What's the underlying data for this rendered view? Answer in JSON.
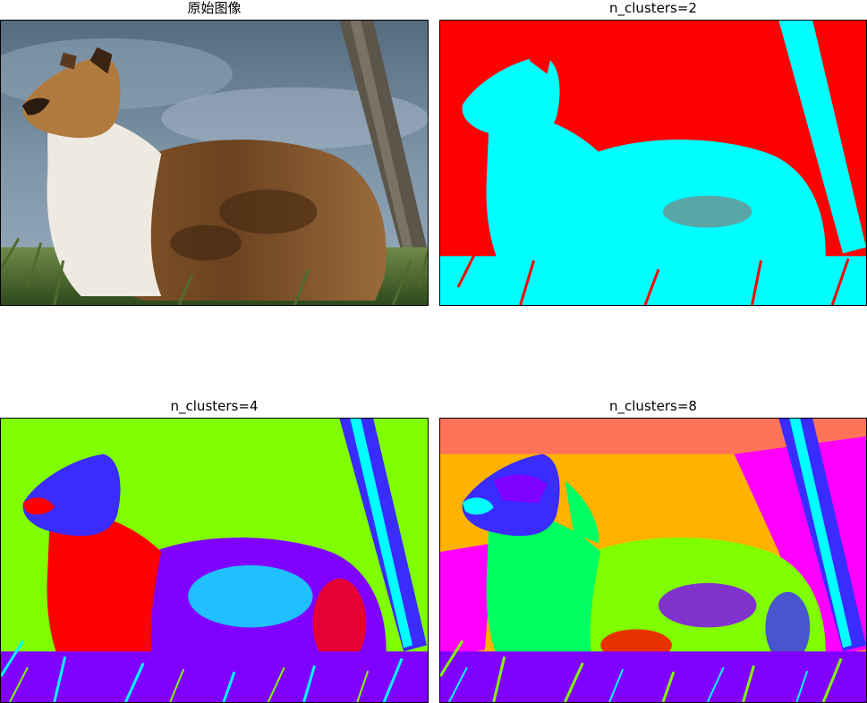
{
  "figure": {
    "panels": [
      {
        "title": "原始图像",
        "n_clusters": null
      },
      {
        "title": "n_clusters=2",
        "n_clusters": 2
      },
      {
        "title": "n_clusters=4",
        "n_clusters": 4
      },
      {
        "title": "n_clusters=8",
        "n_clusters": 8
      }
    ]
  },
  "colors": {
    "k2": [
      "#ff0000",
      "#00ffff"
    ],
    "k4": [
      "#80ff00",
      "#ff0000",
      "#8000ff",
      "#00ffff"
    ],
    "k8": [
      "#ffb300",
      "#ff00ff",
      "#ff0000",
      "#3a2bff",
      "#00ffff",
      "#80ff00",
      "#00ff60",
      "#8000ff"
    ]
  }
}
